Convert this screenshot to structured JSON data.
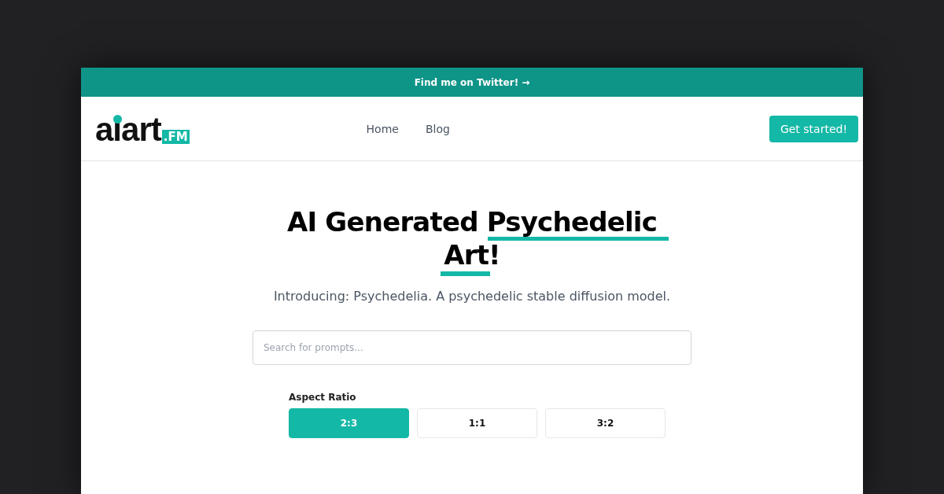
{
  "banner": {
    "text": "Find me on Twitter! →"
  },
  "nav": {
    "logo": {
      "word": "aiart",
      "suffix": ".FM"
    },
    "links": [
      {
        "label": "Home"
      },
      {
        "label": "Blog"
      }
    ],
    "cta": "Get started!"
  },
  "hero": {
    "title": "AI Generated Psychedelic Art!",
    "subtitle": "Introducing: Psychedelia. A psychedelic stable diffusion model."
  },
  "search": {
    "placeholder": "Search for prompts..."
  },
  "aspect_ratio": {
    "label": "Aspect Ratio",
    "options": [
      {
        "label": "2:3",
        "selected": true
      },
      {
        "label": "1:1",
        "selected": false
      },
      {
        "label": "3:2",
        "selected": false
      }
    ]
  }
}
